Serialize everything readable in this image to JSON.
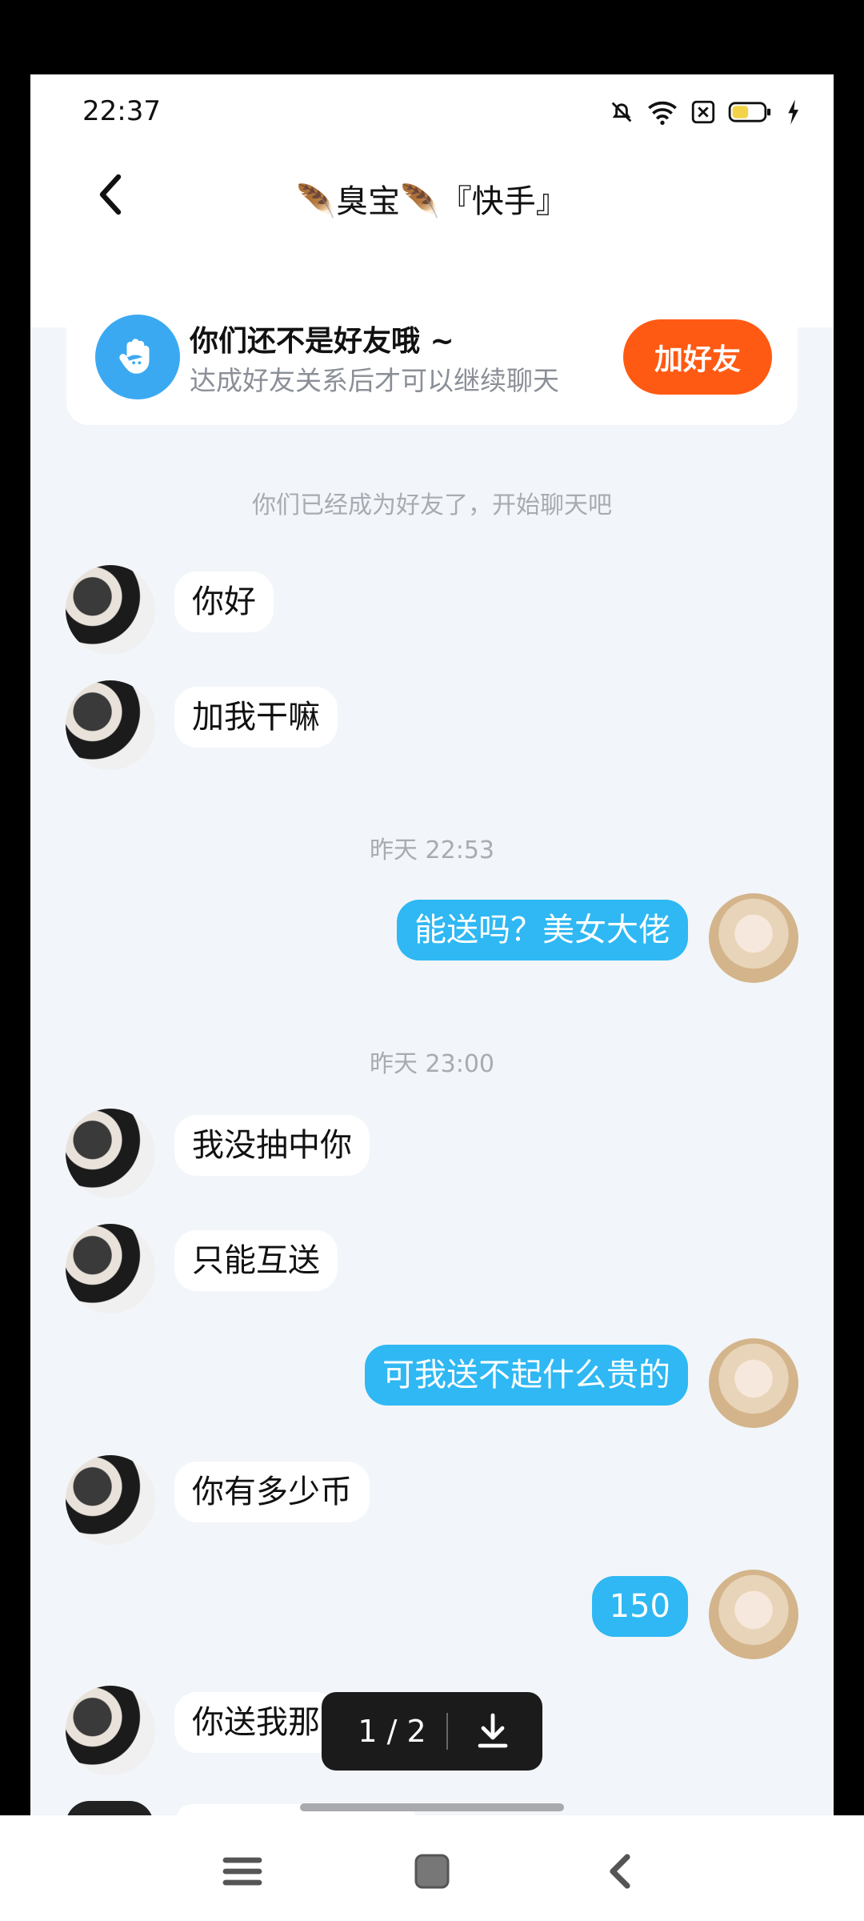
{
  "status_bar": {
    "time": "22:37"
  },
  "header": {
    "title": "🪶臭宝🪶『快手』"
  },
  "friend_card": {
    "title": "你们还不是好友哦 ~",
    "subtitle": "达成好友关系后才可以继续聊天",
    "button_label": "加好友"
  },
  "system_message": "你们已经成为好友了，开始聊天吧",
  "messages": [
    {
      "side": "in",
      "text": "你好"
    },
    {
      "side": "in",
      "text": "加我干嘛"
    },
    {
      "type": "time",
      "text": "昨天 22:53"
    },
    {
      "side": "out",
      "text": "能送吗？美女大佬"
    },
    {
      "type": "time",
      "text": "昨天 23:00"
    },
    {
      "side": "in",
      "text": "我没抽中你"
    },
    {
      "side": "in",
      "text": "只能互送"
    },
    {
      "side": "out",
      "text": "可我送不起什么贵的"
    },
    {
      "side": "in",
      "text": "你有多少币"
    },
    {
      "side": "out",
      "text": "150"
    },
    {
      "side": "in",
      "text": "你送我那"
    }
  ],
  "viewer_overlay": {
    "page": "1 / 2"
  },
  "colors": {
    "accent_blue": "#2FB8F3",
    "add_button": "#FF5A13",
    "background": "#F2F5F9"
  },
  "icons": [
    "back-arrow-icon",
    "mute-bell-icon",
    "wifi-icon",
    "sim-x-icon",
    "battery-icon",
    "charging-icon",
    "wave-hand-icon",
    "download-icon",
    "menu-icon",
    "home-icon",
    "back-icon"
  ]
}
